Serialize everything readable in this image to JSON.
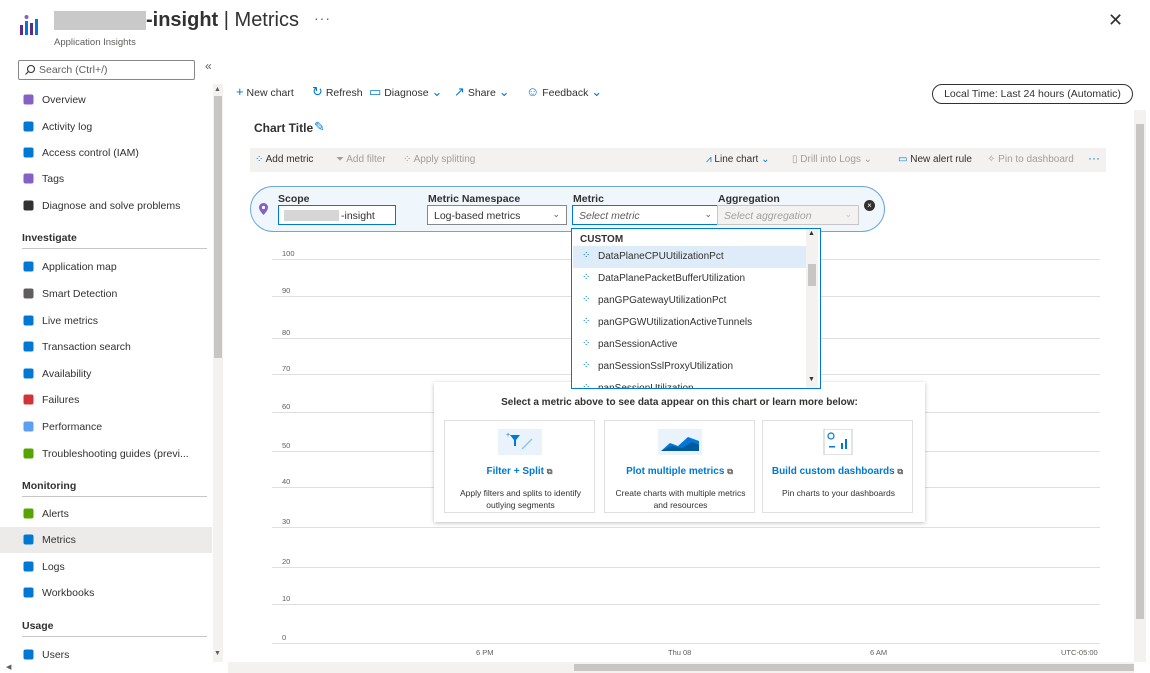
{
  "header": {
    "resource_suffix": "-insight",
    "separator_title": " | Metrics",
    "subtitle": "Application Insights",
    "more": "···",
    "close": "✕"
  },
  "sidebar": {
    "search_placeholder": "Search (Ctrl+/)",
    "collapse": "«",
    "items_top": [
      {
        "label": "Overview",
        "icon": "overview-icon"
      },
      {
        "label": "Activity log",
        "icon": "activity-log-icon"
      },
      {
        "label": "Access control (IAM)",
        "icon": "iam-icon"
      },
      {
        "label": "Tags",
        "icon": "tag-icon"
      },
      {
        "label": "Diagnose and solve problems",
        "icon": "wrench-icon"
      }
    ],
    "section_investigate": "Investigate",
    "items_investigate": [
      {
        "label": "Application map",
        "icon": "app-map-icon"
      },
      {
        "label": "Smart Detection",
        "icon": "smart-detection-icon"
      },
      {
        "label": "Live metrics",
        "icon": "live-metrics-icon"
      },
      {
        "label": "Transaction search",
        "icon": "search-icon"
      },
      {
        "label": "Availability",
        "icon": "availability-icon"
      },
      {
        "label": "Failures",
        "icon": "failures-icon"
      },
      {
        "label": "Performance",
        "icon": "performance-icon"
      },
      {
        "label": "Troubleshooting guides (previ...",
        "icon": "guides-icon"
      }
    ],
    "section_monitoring": "Monitoring",
    "items_monitoring": [
      {
        "label": "Alerts",
        "icon": "alerts-icon"
      },
      {
        "label": "Metrics",
        "icon": "metrics-icon"
      },
      {
        "label": "Logs",
        "icon": "logs-icon"
      },
      {
        "label": "Workbooks",
        "icon": "workbooks-icon"
      }
    ],
    "section_usage": "Usage",
    "items_usage": [
      {
        "label": "Users",
        "icon": "users-icon"
      }
    ]
  },
  "toolbar": {
    "new_chart": "New chart",
    "refresh": "Refresh",
    "diagnose": "Diagnose",
    "share": "Share",
    "feedback": "Feedback",
    "time_range": "Local Time: Last 24 hours (Automatic)"
  },
  "chart": {
    "title": "Chart Title",
    "add_metric": "Add metric",
    "add_filter": "Add filter",
    "apply_splitting": "Apply splitting",
    "line_chart": "Line chart",
    "drill_logs": "Drill into Logs",
    "new_alert": "New alert rule",
    "pin_dashboard": "Pin to dashboard",
    "more": "···",
    "y_ticks": [
      "100",
      "90",
      "80",
      "70",
      "60",
      "50",
      "40",
      "30",
      "20",
      "10",
      "0"
    ],
    "x_ticks": [
      "6 PM",
      "Thu 08",
      "6 AM",
      "UTC-05:00"
    ]
  },
  "metric_selector": {
    "scope_label": "Scope",
    "scope_value": "-insight",
    "namespace_label": "Metric Namespace",
    "namespace_value": "Log-based metrics",
    "metric_label": "Metric",
    "metric_placeholder": "Select metric",
    "aggregation_label": "Aggregation",
    "aggregation_placeholder": "Select aggregation"
  },
  "dropdown": {
    "header": "CUSTOM",
    "items": [
      "DataPlaneCPUUtilizationPct",
      "DataPlanePacketBufferUtilization",
      "panGPGatewayUtilizationPct",
      "panGPGWUtilizationActiveTunnels",
      "panSessionActive",
      "panSessionSslProxyUtilization",
      "panSessionUtilization"
    ]
  },
  "help": {
    "intro": "Select a metric above to see data appear on this chart or learn more below:",
    "cards": [
      {
        "title": "Filter + Split",
        "desc": "Apply filters and splits to identify outlying segments"
      },
      {
        "title": "Plot multiple metrics",
        "desc": "Create charts with multiple metrics and resources"
      },
      {
        "title": "Build custom dashboards",
        "desc": "Pin charts to your dashboards"
      }
    ]
  },
  "colors": {
    "accent": "#0078d4",
    "selected_bg": "#edebe9",
    "highlight": "#deecf9"
  }
}
